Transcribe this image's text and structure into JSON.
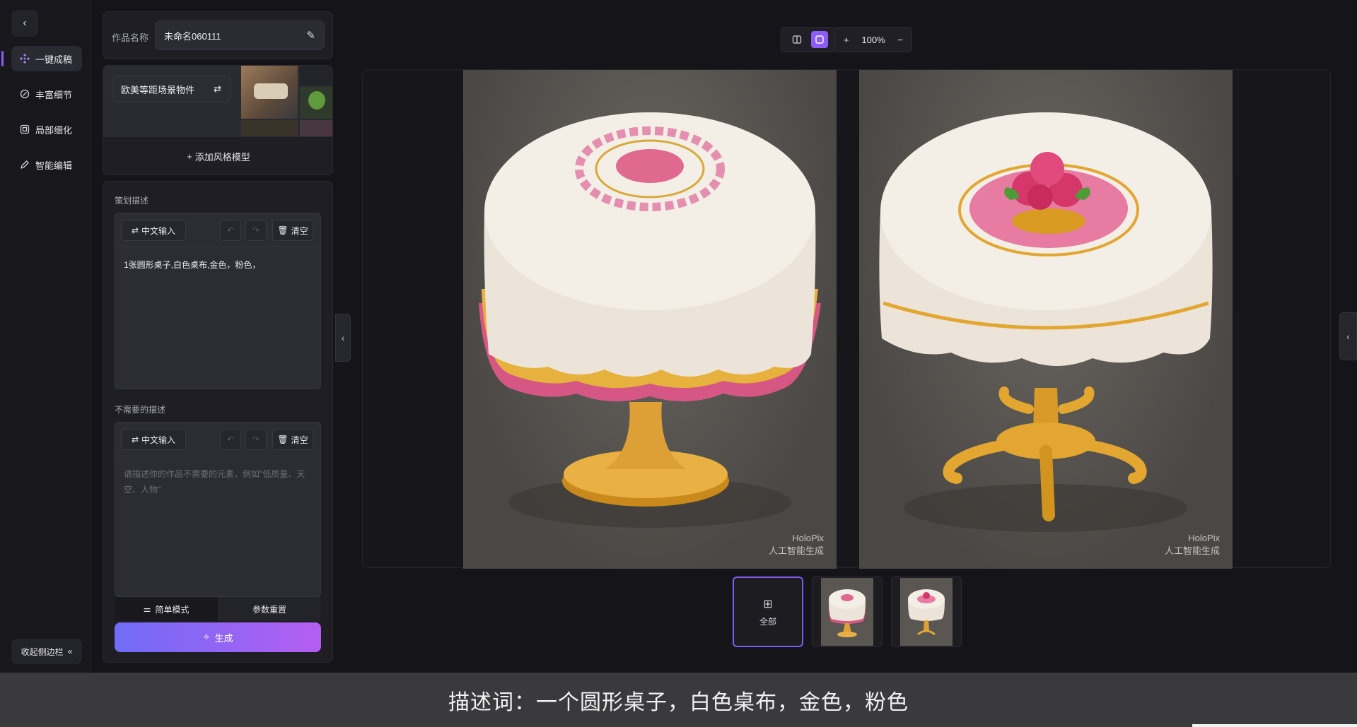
{
  "nav": {
    "items": [
      {
        "label": "一键成稿",
        "icon": "magic-grid-icon",
        "active": true
      },
      {
        "label": "丰富细节",
        "icon": "detail-icon",
        "active": false
      },
      {
        "label": "局部细化",
        "icon": "region-icon",
        "active": false
      },
      {
        "label": "智能编辑",
        "icon": "pen-icon",
        "active": false
      }
    ],
    "collapse_label": "收起侧边栏"
  },
  "work": {
    "name_label": "作品名称",
    "name_value": "未命名060111"
  },
  "style": {
    "chip_label": "欧美等距场景物件",
    "add_label": "添加风格模型"
  },
  "prompt": {
    "section_label": "策划描述",
    "input_mode_label": "中文输入",
    "clear_label": "清空",
    "text": "1张圆形桌子,白色桌布,金色，粉色，"
  },
  "negative": {
    "section_label": "不需要的描述",
    "input_mode_label": "中文输入",
    "clear_label": "清空",
    "placeholder": "请描述你的作品不需要的元素，例如\"低质量、天空、人物\""
  },
  "controls": {
    "simple_mode_label": "简单模式",
    "reset_label": "参数重置",
    "generate_label": "生成"
  },
  "viewer": {
    "zoom_level": "100%",
    "thumbs_all_label": "全部"
  },
  "results": [
    {
      "watermark_brand": "HoloPix",
      "watermark_note": "人工智能生成"
    },
    {
      "watermark_brand": "HoloPix",
      "watermark_note": "人工智能生成"
    }
  ],
  "caption": "描述词：一个圆形桌子，白色桌布，金色，粉色",
  "colors": {
    "accent": "#8b5cf6",
    "generate_start": "#6f6cf6",
    "generate_end": "#b55ef2",
    "tablecloth": "#f1ebe2",
    "gold": "#d99a22",
    "pink": "#e0638f"
  }
}
